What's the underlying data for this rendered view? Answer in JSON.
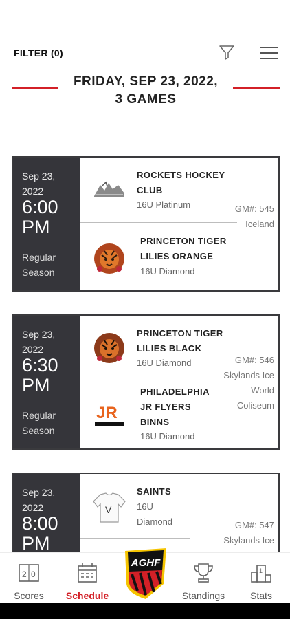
{
  "header": {
    "filter_label": "FILTER (0)"
  },
  "date_header": {
    "line1": "FRIDAY, SEP 23, 2022,",
    "line2": "3 GAMES"
  },
  "games": [
    {
      "date": "Sep 23, 2022",
      "time": "6:00 PM",
      "season": "Regular Season",
      "gm_number": "GM#: 545",
      "venue": "Iceland",
      "home": {
        "name_line1": "ROCKETS HOCKEY",
        "name_line2": "CLUB",
        "division": "16U Platinum"
      },
      "away": {
        "name_line1": "PRINCETON TIGER",
        "name_line2": "LILIES ORANGE",
        "division": "16U Diamond"
      }
    },
    {
      "date": "Sep 23, 2022",
      "time": "6:30 PM",
      "season": "Regular Season",
      "gm_number": "GM#: 546",
      "venue": "Skylands Ice World Coliseum",
      "home": {
        "name_line1": "PRINCETON TIGER",
        "name_line2": "LILIES BLACK",
        "division": "16U Diamond"
      },
      "away": {
        "name_line1": "PHILADELPHIA",
        "name_line2": "JR FLYERS",
        "name_line3": "BINNS",
        "division": "16U Diamond"
      }
    },
    {
      "date": "Sep 23, 2022",
      "time": "8:00 PM",
      "gm_number": "GM#: 547",
      "venue": "Skylands Ice",
      "home": {
        "name_line1": "SAINTS",
        "division_line1": "16U",
        "division_line2": "Diamond",
        "jersey_letter": "V"
      }
    }
  ],
  "nav": {
    "scores": "Scores",
    "schedule": "Schedule",
    "logo_text": "AGHF",
    "standings": "Standings",
    "stats": "Stats"
  },
  "colors": {
    "accent": "#d32027",
    "card_dark": "#35353a"
  },
  "icons": {
    "filter": "funnel-icon",
    "menu": "hamburger-icon",
    "scores": "scoreboard-icon",
    "schedule": "calendar-icon",
    "standings": "trophy-icon",
    "stats": "podium-icon"
  }
}
